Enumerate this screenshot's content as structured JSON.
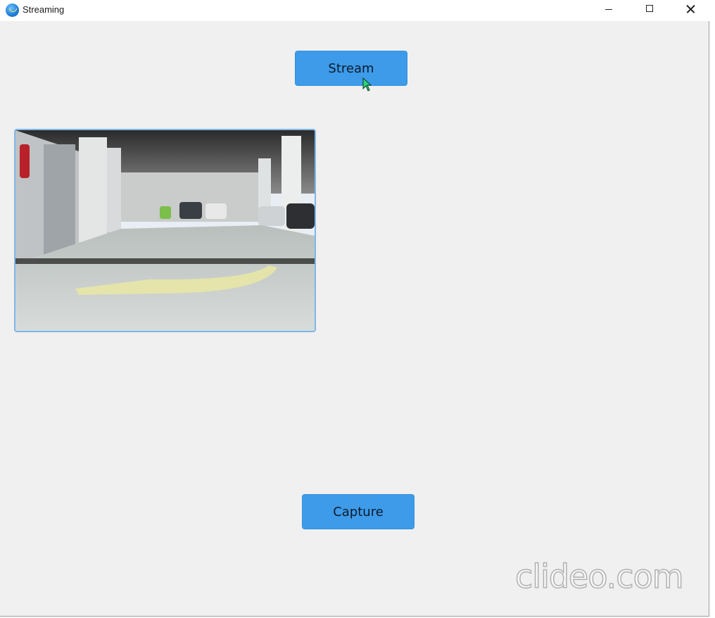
{
  "window": {
    "title": "Streaming"
  },
  "buttons": {
    "stream_label": "Stream",
    "capture_label": "Capture"
  },
  "watermark": {
    "text": "clideo.com"
  },
  "colors": {
    "button_bg": "#3d9be9",
    "frame_border": "#7fb6ea",
    "window_bg": "#f0f0f0"
  },
  "icons": {
    "app": "app-globe-icon",
    "minimize": "minimize-icon",
    "maximize": "maximize-icon",
    "close": "close-icon",
    "cursor": "mouse-cursor-icon"
  }
}
